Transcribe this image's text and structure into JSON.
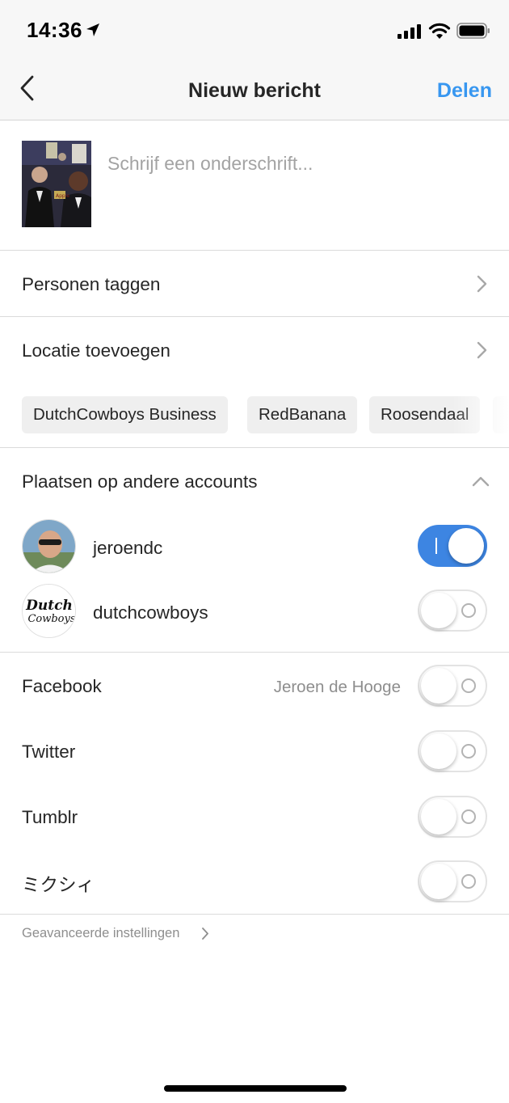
{
  "status_bar": {
    "time": "14:36",
    "icons": [
      "location-arrow-icon",
      "cellular-signal-icon",
      "wifi-icon",
      "battery-icon"
    ]
  },
  "nav": {
    "back_icon": "chevron-left-icon",
    "title": "Nieuw bericht",
    "share_label": "Delen",
    "accent_color": "#3897f0"
  },
  "compose": {
    "caption_placeholder": "Schrijf een onderschrift..."
  },
  "tag_people": {
    "label": "Personen taggen"
  },
  "location": {
    "label": "Locatie toevoegen",
    "suggestions": [
      "DutchCowboys Business",
      "RedBanana",
      "Roosendaal"
    ]
  },
  "other_accounts": {
    "label": "Plaatsen op andere accounts",
    "collapse_icon": "chevron-up-icon",
    "accounts": [
      {
        "name": "jeroendc",
        "enabled": true
      },
      {
        "name": "dutchcowboys",
        "enabled": false,
        "avatar_logo_text": "Dutch Cowboys"
      }
    ]
  },
  "services": [
    {
      "name": "Facebook",
      "account": "Jeroen de Hooge",
      "enabled": false
    },
    {
      "name": "Twitter",
      "enabled": false
    },
    {
      "name": "Tumblr",
      "enabled": false
    },
    {
      "name": "ミクシィ",
      "enabled": false
    }
  ],
  "advanced": {
    "label": "Geavanceerde instellingen"
  },
  "toggle_on_color": "#3d85e2"
}
